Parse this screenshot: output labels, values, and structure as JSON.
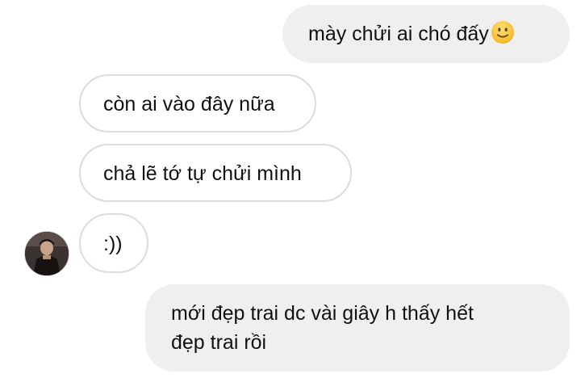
{
  "messages": [
    {
      "direction": "sent",
      "text": "mày chửi ai chó đấy",
      "emoji": "slightly-smiling-face"
    },
    {
      "direction": "received",
      "text": "còn ai vào đây nữa"
    },
    {
      "direction": "received",
      "text": "chả lẽ tớ tự chửi mình"
    },
    {
      "direction": "received",
      "text": ":))"
    },
    {
      "direction": "sent",
      "lines": [
        "mới đẹp trai dc vài giây h thấy hết",
        "đẹp trai rồi"
      ]
    }
  ],
  "colors": {
    "sent_bubble": "#efefef",
    "received_border": "#dcdcdc",
    "text": "#111111"
  }
}
